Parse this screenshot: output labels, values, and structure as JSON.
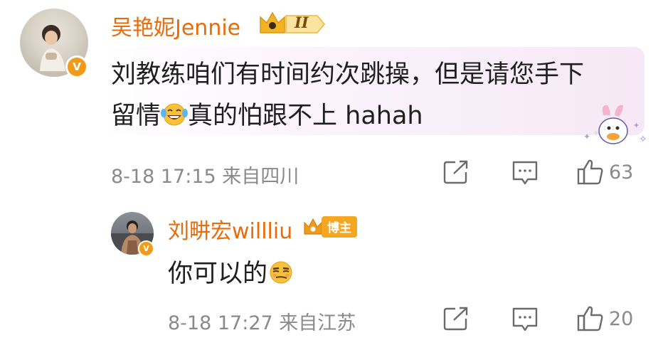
{
  "comments": [
    {
      "username": "吴艳妮Jennie",
      "rank_badge": "II",
      "text_line1": "刘教练咱们有时间约次跳操，但是请您手下",
      "text_line2_a": "留情",
      "text_line2_b": "真的怕跟不上 hahah",
      "emoji": "laugh-cry-emoji",
      "meta": "8-18 17:15  来自四川",
      "likes": "63",
      "verified": "V"
    },
    {
      "username": "刘畊宏willliu",
      "badge": "博主",
      "text": "你可以的",
      "emoji": "smug-face-emoji",
      "meta": "8-18 17:27  来自江苏",
      "likes": "20",
      "verified": "V"
    }
  ],
  "icons": {
    "share": "share-icon",
    "comment": "comment-icon",
    "like": "thumbs-up-icon"
  },
  "colors": {
    "username": "#e86b0c",
    "meta": "#8a8a8a",
    "badge_gold": "#f2b422",
    "verified": "#f29a1a"
  }
}
